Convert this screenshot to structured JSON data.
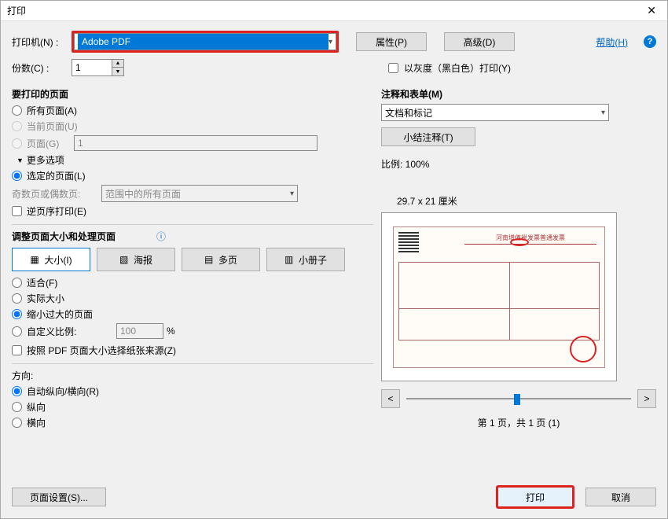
{
  "window": {
    "title": "打印"
  },
  "header": {
    "printer_label": "打印机(N) :",
    "printer_value": "Adobe PDF",
    "properties_btn": "属性(P)",
    "advanced_btn": "高级(D)",
    "help_link": "帮助(H)",
    "copies_label": "份数(C) :",
    "copies_value": "1",
    "grayscale_label": "以灰度（黑白色）打印(Y)"
  },
  "pages": {
    "title": "要打印的页面",
    "all": "所有页面(A)",
    "current": "当前页面(U)",
    "pages_label": "页面(G)",
    "pages_value": "1",
    "more_options": "更多选项",
    "selected_pages": "选定的页面(L)",
    "odd_even_label": "奇数页或偶数页:",
    "odd_even_value": "范围中的所有页面",
    "reverse": "逆页序打印(E)"
  },
  "sizing": {
    "title": "调整页面大小和处理页面",
    "tab_size": "大小(I)",
    "tab_poster": "海报",
    "tab_multi": "多页",
    "tab_booklet": "小册子",
    "fit": "适合(F)",
    "actual": "实际大小",
    "shrink": "缩小过大的页面",
    "custom": "自定义比例:",
    "custom_value": "100",
    "percent": "%",
    "choose_paper": "按照 PDF 页面大小选择纸张来源(Z)"
  },
  "orientation": {
    "title": "方向:",
    "auto": "自动纵向/横向(R)",
    "portrait": "纵向",
    "landscape": "横向"
  },
  "right": {
    "comments_title": "注释和表单(M)",
    "comments_value": "文档和标记",
    "summarize_btn": "小结注释(T)",
    "scale_label": "比例:  100%",
    "paper_size": "29.7 x 21 厘米",
    "preview_header": "河南增值税发票普通发票",
    "page_info": "第 1 页，共 1 页 (1)"
  },
  "footer": {
    "page_setup": "页面设置(S)...",
    "print": "打印",
    "cancel": "取消"
  }
}
